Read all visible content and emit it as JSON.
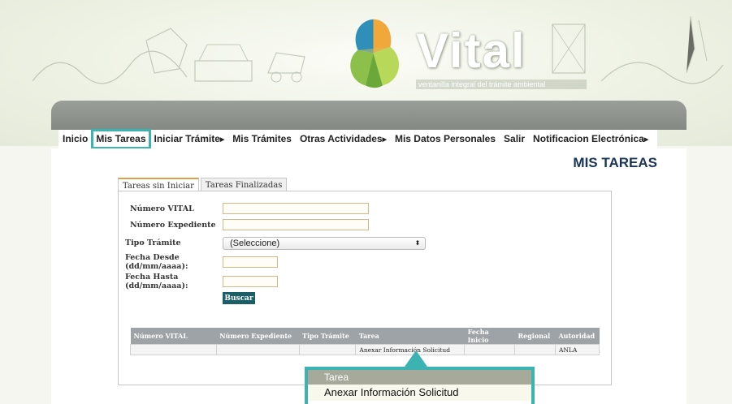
{
  "header": {
    "brand": "Vital",
    "tagline": "ventanilla integral del trámite ambiental"
  },
  "nav": {
    "items": [
      {
        "label": "Inicio",
        "has_arrow": false
      },
      {
        "label": "Mis Tareas",
        "has_arrow": false,
        "selected": true
      },
      {
        "label": "Iniciar Trámite",
        "has_arrow": true
      },
      {
        "label": "Mis Trámites",
        "has_arrow": false
      },
      {
        "label": "Otras Actividades",
        "has_arrow": true
      },
      {
        "label": "Mis Datos Personales",
        "has_arrow": false
      },
      {
        "label": "Salir",
        "has_arrow": false
      },
      {
        "label": "Notificacion Electrónica",
        "has_arrow": true
      }
    ]
  },
  "page": {
    "title": "MIS TAREAS"
  },
  "tabs": [
    "Tareas sin Iniciar",
    "Tareas Finalizadas"
  ],
  "form": {
    "numero_vital_label": "Número VITAL",
    "numero_vital_value": "",
    "numero_expediente_label": "Número Expediente",
    "numero_expediente_value": "",
    "tipo_tramite_label": "Tipo Trámite",
    "tipo_tramite_value": "(Seleccione)",
    "fecha_desde_label_1": "Fecha Desde",
    "fecha_desde_label_2": "(dd/mm/aaaa):",
    "fecha_desde_value": "",
    "fecha_hasta_label_1": "Fecha Hasta",
    "fecha_hasta_label_2": "(dd/mm/aaaa):",
    "fecha_hasta_value": "",
    "buscar_label": "Buscar"
  },
  "table": {
    "columns": [
      "Número VITAL",
      "Número Expediente",
      "Tipo Trámite",
      "Tarea",
      "Fecha Inicio",
      "Regional",
      "Autoridad"
    ],
    "rows": [
      [
        "",
        "",
        "",
        "Anexar Información Solicitud",
        "",
        "",
        "ANLA"
      ]
    ]
  },
  "tooltip": {
    "header": "Tarea",
    "value": "Anexar Información Solicitud"
  },
  "colors": {
    "accent": "#3bb3b3",
    "title_blue": "#1a3556",
    "button": "#1a5f68",
    "table_header": "#9da3a7",
    "tab_active_border": "#e0a04a"
  }
}
